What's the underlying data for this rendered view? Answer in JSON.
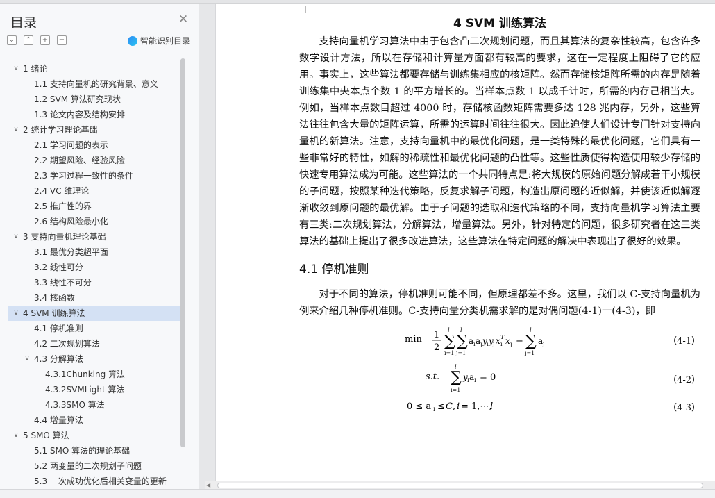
{
  "sidebar": {
    "title": "目录",
    "tools": [
      {
        "icon": "collapse-icon",
        "glyph": "⌄"
      },
      {
        "icon": "expand-icon",
        "glyph": "⌃"
      },
      {
        "icon": "add-icon",
        "glyph": "+"
      },
      {
        "icon": "remove-icon",
        "glyph": "−"
      }
    ],
    "smart_toc_label": "智能识别目录",
    "toc": [
      {
        "level": 1,
        "chev": "∨",
        "label": "1  绪论"
      },
      {
        "level": 2,
        "label": "1.1 支持向量机的研究背景、意义"
      },
      {
        "level": 2,
        "label": "1.2 SVM 算法研究现状"
      },
      {
        "level": 2,
        "label": "1.3  论文内容及结构安排"
      },
      {
        "level": 1,
        "chev": "∨",
        "label": "2  统计学习理论基础"
      },
      {
        "level": 2,
        "label": "2.1  学习问题的表示"
      },
      {
        "level": 2,
        "label": "2.2  期望风险、经验风险"
      },
      {
        "level": 2,
        "label": "2.3  学习过程一致性的条件"
      },
      {
        "level": 2,
        "label": "2.4 VC 维理论"
      },
      {
        "level": 2,
        "label": "2.5  推广性的界"
      },
      {
        "level": 2,
        "label": "2.6  结构风险最小化"
      },
      {
        "level": 1,
        "chev": "∨",
        "label": "3  支持向量机理论基础"
      },
      {
        "level": 2,
        "label": "3.1  最优分类超平面"
      },
      {
        "level": 2,
        "label": "3.2  线性可分"
      },
      {
        "level": 2,
        "label": "3.3  线性不可分"
      },
      {
        "level": 2,
        "label": "3.4  核函数"
      },
      {
        "level": 1,
        "chev": "∨",
        "label": "4 SVM 训练算法",
        "selected": true
      },
      {
        "level": 2,
        "label": "4.1  停机准则"
      },
      {
        "level": 2,
        "label": "4.2  二次规划算法"
      },
      {
        "level": 2,
        "chev": "∨",
        "label": "4.3  分解算法"
      },
      {
        "level": 3,
        "label": "4.3.1Chunking 算法"
      },
      {
        "level": 3,
        "label": "4.3.2SVMLight 算法"
      },
      {
        "level": 3,
        "label": "4.3.3SMO 算法"
      },
      {
        "level": 2,
        "label": "4.4  增量算法"
      },
      {
        "level": 1,
        "chev": "∨",
        "label": "5 SMO 算法"
      },
      {
        "level": 2,
        "label": "5.1 SMO 算法的理论基础"
      },
      {
        "level": 2,
        "label": "5.2  两变量的二次规划子问题"
      },
      {
        "level": 2,
        "label": "5.3  一次成功优化后相关变量的更新"
      }
    ]
  },
  "document": {
    "chapter_title": "4 SVM 训练算法",
    "paragraph1": "支持向量机学习算法中由于包含凸二次规划问题，而且其算法的复杂性较高，包含许多数学设计方法，所以在存储和计算量方面都有较高的要求，这在一定程度上阻碍了它的应用。事实上，这些算法都要存储与训练集相应的核矩阵。然而存储核矩阵所需的内存是随着训练集中央本点个数 1 的平方增长的。当样本点数 1 以成千计时，所需的内存己相当大。例如，当样本点数目超过 4000 时，存储核函数矩阵需要多达 128 兆内存，另外，这些算法往往包含大量的矩阵运算，所需的运算时间往往很大。因此迫使人们设计专门针对支持向量机的新算法。注意，支持向量机中的最优化问题，是一类特殊的最优化问题，它们具有一些非常好的特性，如解的稀疏性和最优化问题的凸性等。这些性质使得构造使用较少存储的快速专用算法成为可能。这些算法的一个共同特点是:将大规模的原始问题分解成若干小规模的子问题，按照某种迭代策略，反复求解子问题，构造出原问题的近似解，并使该近似解逐渐收敛到原问题的最优解。由于子问题的选取和迭代策略的不同，支持向量机学习算法主要有三类:二次规划算法，分解算法，增量算法。另外，针对特定的问题，很多研究者在这三类算法的基础上提出了很多改进算法，这些算法在特定问题的解决中表现出了很好的效果。",
    "section_title": "4.1  停机准则",
    "paragraph2": "对于不同的算法，停机准则可能不同，但原理都差不多。这里，我们以 C-支持向量机为例来介绍几种停机准则。C-支持向量分类机需求解的是对偶问题(4-1)一(4-3)，即",
    "equations": [
      {
        "number": "（4-1）",
        "prefix": "min"
      },
      {
        "number": "（4-2）",
        "prefix": "s.t."
      },
      {
        "number": "（4-3）",
        "prefix": ""
      }
    ]
  },
  "colors": {
    "sidebar_bg": "#f7f8fa",
    "selected_bg": "#d4e1f4",
    "page_bg": "#ffffff",
    "workspace_bg": "#e6e7e9"
  }
}
